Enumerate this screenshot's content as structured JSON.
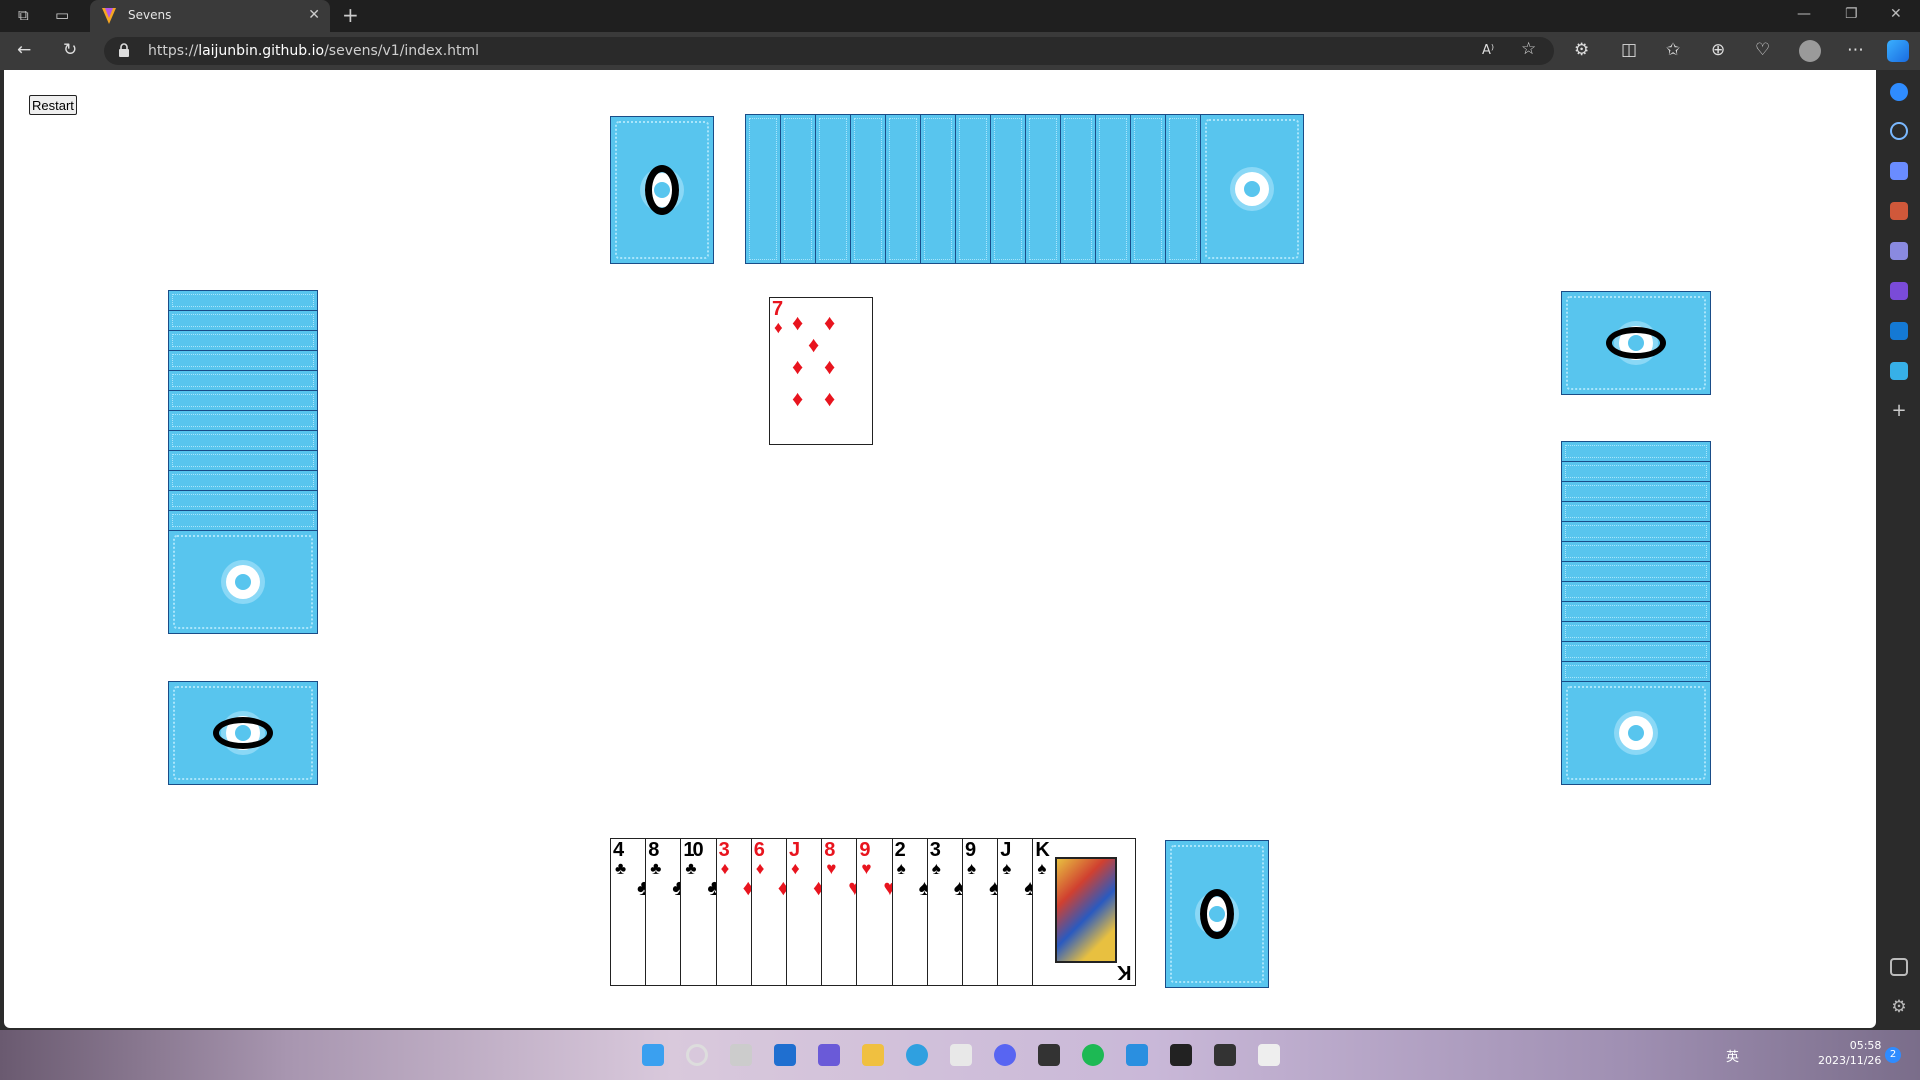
{
  "browser": {
    "tab_title": "Sevens",
    "url_prefix": "https://",
    "url_host": "laijunbin.github.io",
    "url_path": "/sevens/v1/index.html"
  },
  "game": {
    "restart_label": "Restart",
    "opponents": {
      "top": {
        "hand_count": 14,
        "won_pile_count": "0"
      },
      "left": {
        "hand_count": 13,
        "won_pile_count": "0"
      },
      "right": {
        "hand_count": 13,
        "won_pile_count": "0"
      }
    },
    "table_cards": [
      {
        "rank": "7",
        "suit": "♦",
        "color": "red"
      }
    ],
    "player_won_pile_count": "0",
    "player_hand": [
      {
        "rank": "4",
        "suit": "♣",
        "color": "black"
      },
      {
        "rank": "8",
        "suit": "♣",
        "color": "black"
      },
      {
        "rank": "10",
        "suit": "♣",
        "color": "black"
      },
      {
        "rank": "3",
        "suit": "♦",
        "color": "red"
      },
      {
        "rank": "6",
        "suit": "♦",
        "color": "red"
      },
      {
        "rank": "J",
        "suit": "♦",
        "color": "red"
      },
      {
        "rank": "8",
        "suit": "♥",
        "color": "red"
      },
      {
        "rank": "9",
        "suit": "♥",
        "color": "red"
      },
      {
        "rank": "2",
        "suit": "♠",
        "color": "black"
      },
      {
        "rank": "3",
        "suit": "♠",
        "color": "black"
      },
      {
        "rank": "9",
        "suit": "♠",
        "color": "black"
      },
      {
        "rank": "J",
        "suit": "♠",
        "color": "black"
      },
      {
        "rank": "K",
        "suit": "♠",
        "color": "black"
      }
    ]
  },
  "colors": {
    "card_back": "#58c5ee",
    "red_suit": "#e8141e",
    "black_suit": "#000000"
  },
  "taskbar": {
    "time": "05:58",
    "date": "2023/11/26",
    "notification_count": "2",
    "ime": "英"
  }
}
